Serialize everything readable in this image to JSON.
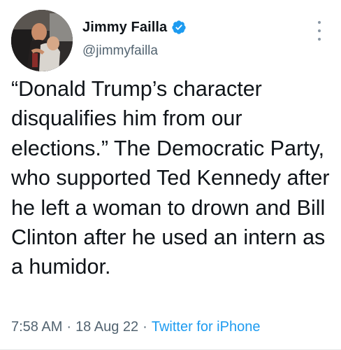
{
  "author": {
    "display_name": "Jimmy Failla",
    "handle": "@jimmyfailla",
    "verified": true,
    "verified_icon": "verified-badge-icon",
    "avatar": "profile-photo"
  },
  "tweet": {
    "text": "“Donald Trump’s character disqualifies him from our elections.” The Democratic Party, who supported Ted Kennedy after he left a woman to drown and Bill Clinton after he used an intern as a humidor."
  },
  "meta": {
    "time": "7:58 AM",
    "separator": "·",
    "date": "18 Aug 22",
    "source": "Twitter for iPhone"
  },
  "menu": {
    "icon": "more-options-icon"
  },
  "colors": {
    "text": "#0f1419",
    "secondary": "#536471",
    "link": "#1d9bf0",
    "verified": "#1d9bf0"
  }
}
